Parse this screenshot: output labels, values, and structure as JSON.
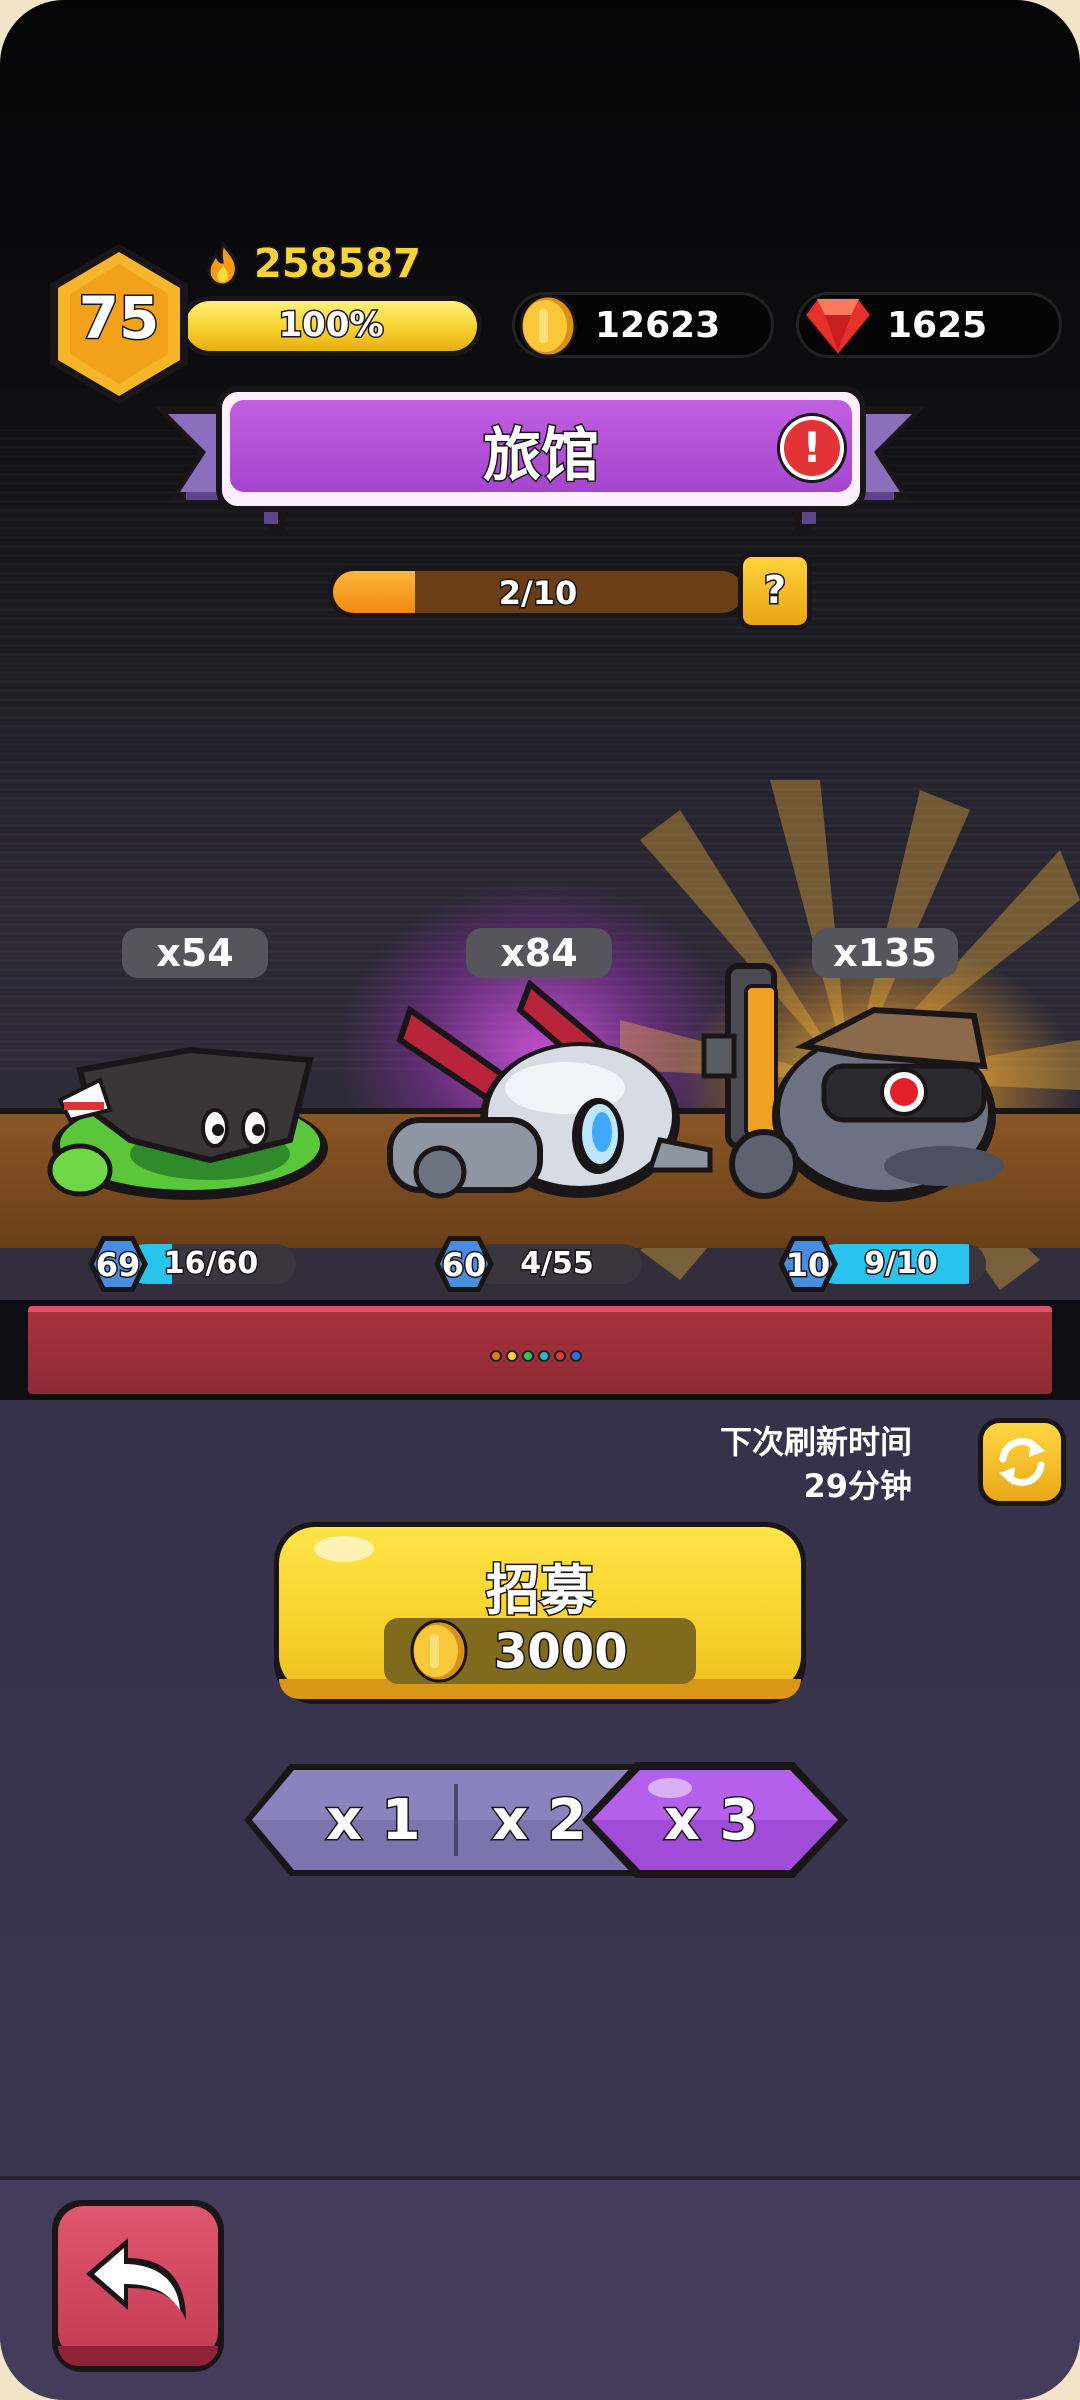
{
  "player": {
    "level": "75",
    "power": "258587",
    "xp_percent": 100,
    "xp_label": "100%"
  },
  "resources": {
    "coins": "12623",
    "gems": "1625"
  },
  "banner": {
    "title": "旅馆",
    "alert": "!"
  },
  "progress": {
    "current": 2,
    "max": 10,
    "label": "2/10",
    "help": "?"
  },
  "heroes": [
    {
      "count": "x54",
      "level": "69",
      "shards": "16/60",
      "shard_fraction": 0.27,
      "name": "green-slime-hero"
    },
    {
      "count": "x84",
      "level": "60",
      "shards": "4/55",
      "shard_fraction": 0.07,
      "name": "silver-robot-hero"
    },
    {
      "count": "x135",
      "level": "10",
      "shards": "9/10",
      "shard_fraction": 0.9,
      "name": "armored-cannon-hero"
    }
  ],
  "dots_colors": [
    "#e27a1f",
    "#f3d532",
    "#36c15a",
    "#2fb3cf",
    "#e23a3a",
    "#2f6fe0"
  ],
  "refresh": {
    "line1": "下次刷新时间",
    "line2": "29分钟"
  },
  "recruit": {
    "title": "招募",
    "cost": "3000"
  },
  "multipliers": {
    "options": [
      "x 1",
      "x 2",
      "x 3"
    ],
    "selected": "x 3"
  },
  "colors": {
    "accent_purple": "#a545cf",
    "gold": "#f7d22d",
    "xp_blue": "#29c4ee",
    "back_red": "#c43b54"
  }
}
